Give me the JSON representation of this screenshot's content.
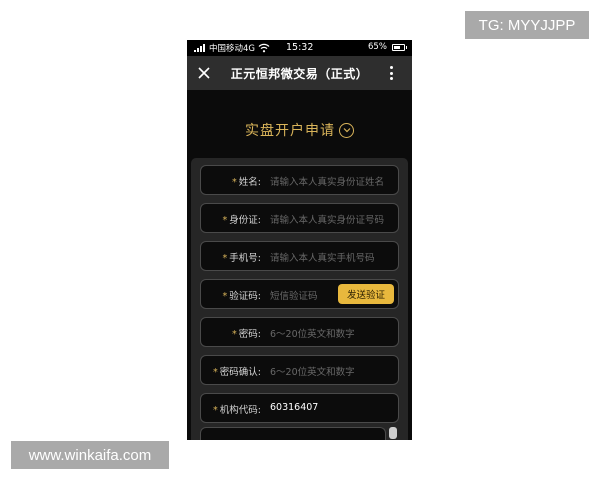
{
  "watermarks": {
    "top": "TG: MYYJJPP",
    "bottom": "www.winkaifa.com"
  },
  "status_bar": {
    "carrier": "中国移动4G",
    "time": "15:32",
    "battery": "65%"
  },
  "nav": {
    "title": "正元恒邦微交易（正式）"
  },
  "heading": {
    "text": "实盘开户申请"
  },
  "form": {
    "name": {
      "label": "姓名:",
      "placeholder": "请输入本人真实身份证姓名"
    },
    "id_card": {
      "label": "身份证:",
      "placeholder": "请输入本人真实身份证号码"
    },
    "phone": {
      "label": "手机号:",
      "placeholder": "请输入本人真实手机号码"
    },
    "code": {
      "label": "验证码:",
      "placeholder": "短信验证码",
      "button": "发送验证"
    },
    "password": {
      "label": "密码:",
      "placeholder": "6～20位英文和数字"
    },
    "password_confirm": {
      "label": "密码确认:",
      "placeholder": "6～20位英文和数字"
    },
    "org_code": {
      "label": "机构代码:",
      "value": "60316407"
    },
    "required_mark": "*"
  },
  "colors": {
    "accent": "#d9b45a",
    "button": "#e8b83d",
    "background": "#0b0b0b",
    "panel": "#262626"
  }
}
